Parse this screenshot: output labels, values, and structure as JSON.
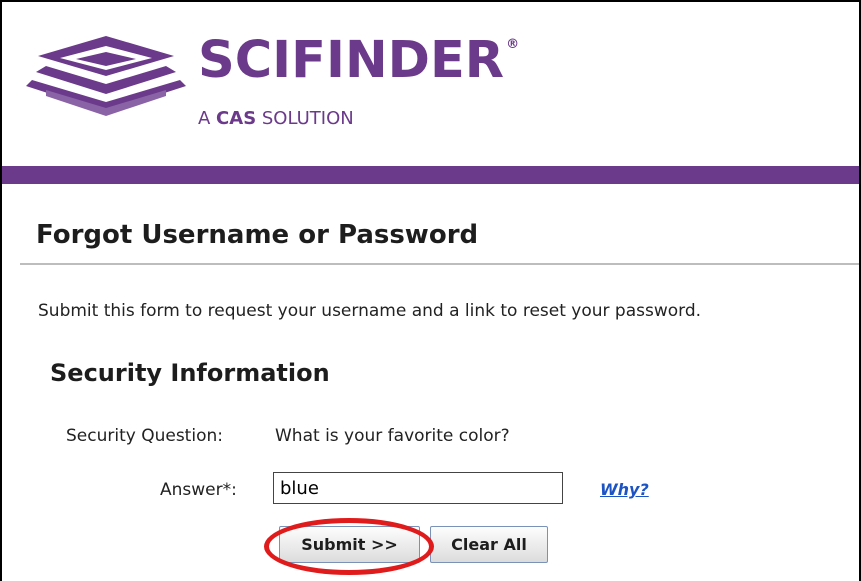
{
  "brand": {
    "name_prefix": "S",
    "name_rest": "CIFINDER",
    "registered_mark": "®",
    "tagline_a": "A ",
    "tagline_cas": "CAS",
    "tagline_solution": " SOLUTION",
    "accent_color": "#6b3a8a"
  },
  "page": {
    "title": "Forgot Username or Password",
    "intro": "Submit this form to request your username and a link to reset your password."
  },
  "security": {
    "section_title": "Security Information",
    "question_label": "Security Question:",
    "question_value": "What is your favorite color?",
    "answer_label": "Answer*:",
    "answer_value": "blue",
    "why_link": "Why?"
  },
  "buttons": {
    "submit_label": "Submit >>",
    "clear_label": "Clear All"
  },
  "annotation": {
    "highlight_color": "#e01b1b"
  }
}
